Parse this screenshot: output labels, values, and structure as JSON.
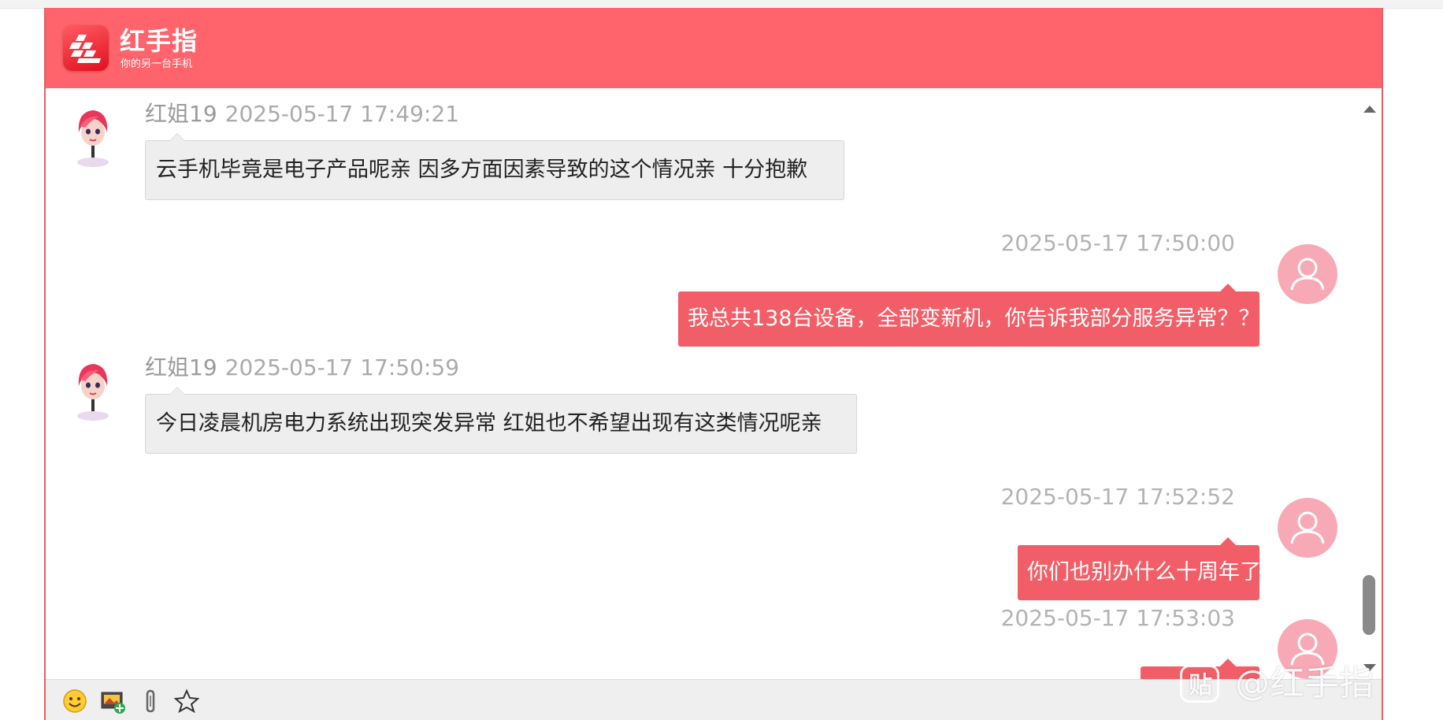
{
  "brand": {
    "name": "红手指",
    "slogan": "你的另一台手机"
  },
  "messages": [
    {
      "side": "agent",
      "sender": "红姐19",
      "time": "2025-05-17 17:49:21",
      "text": "云手机毕竟是电子产品呢亲 因多方面因素导致的这个情况亲 十分抱歉"
    },
    {
      "side": "user",
      "time": "2025-05-17 17:50:00",
      "text": "我总共138台设备，全部变新机，你告诉我部分服务异常？？？"
    },
    {
      "side": "agent",
      "sender": "红姐19",
      "time": "2025-05-17 17:50:59",
      "text": "今日凌晨机房电力系统出现突发异常 红姐也不希望出现有这类情况呢亲"
    },
    {
      "side": "user",
      "time": "2025-05-17 17:52:52",
      "text": "你们也别办什么十周年了"
    },
    {
      "side": "user",
      "time": "2025-05-17 17:53:03",
      "text": ""
    }
  ],
  "toolbar": {
    "icons": [
      "smiley-icon",
      "image-upload-icon",
      "paperclip-icon",
      "star-icon"
    ]
  },
  "watermark": {
    "badge": "贴",
    "text": "@红手指"
  },
  "colors": {
    "header": "#ff636b",
    "user_bubble": "#f25e67",
    "agent_bubble": "#eeeeee",
    "user_avatar": "#f7aab6"
  }
}
